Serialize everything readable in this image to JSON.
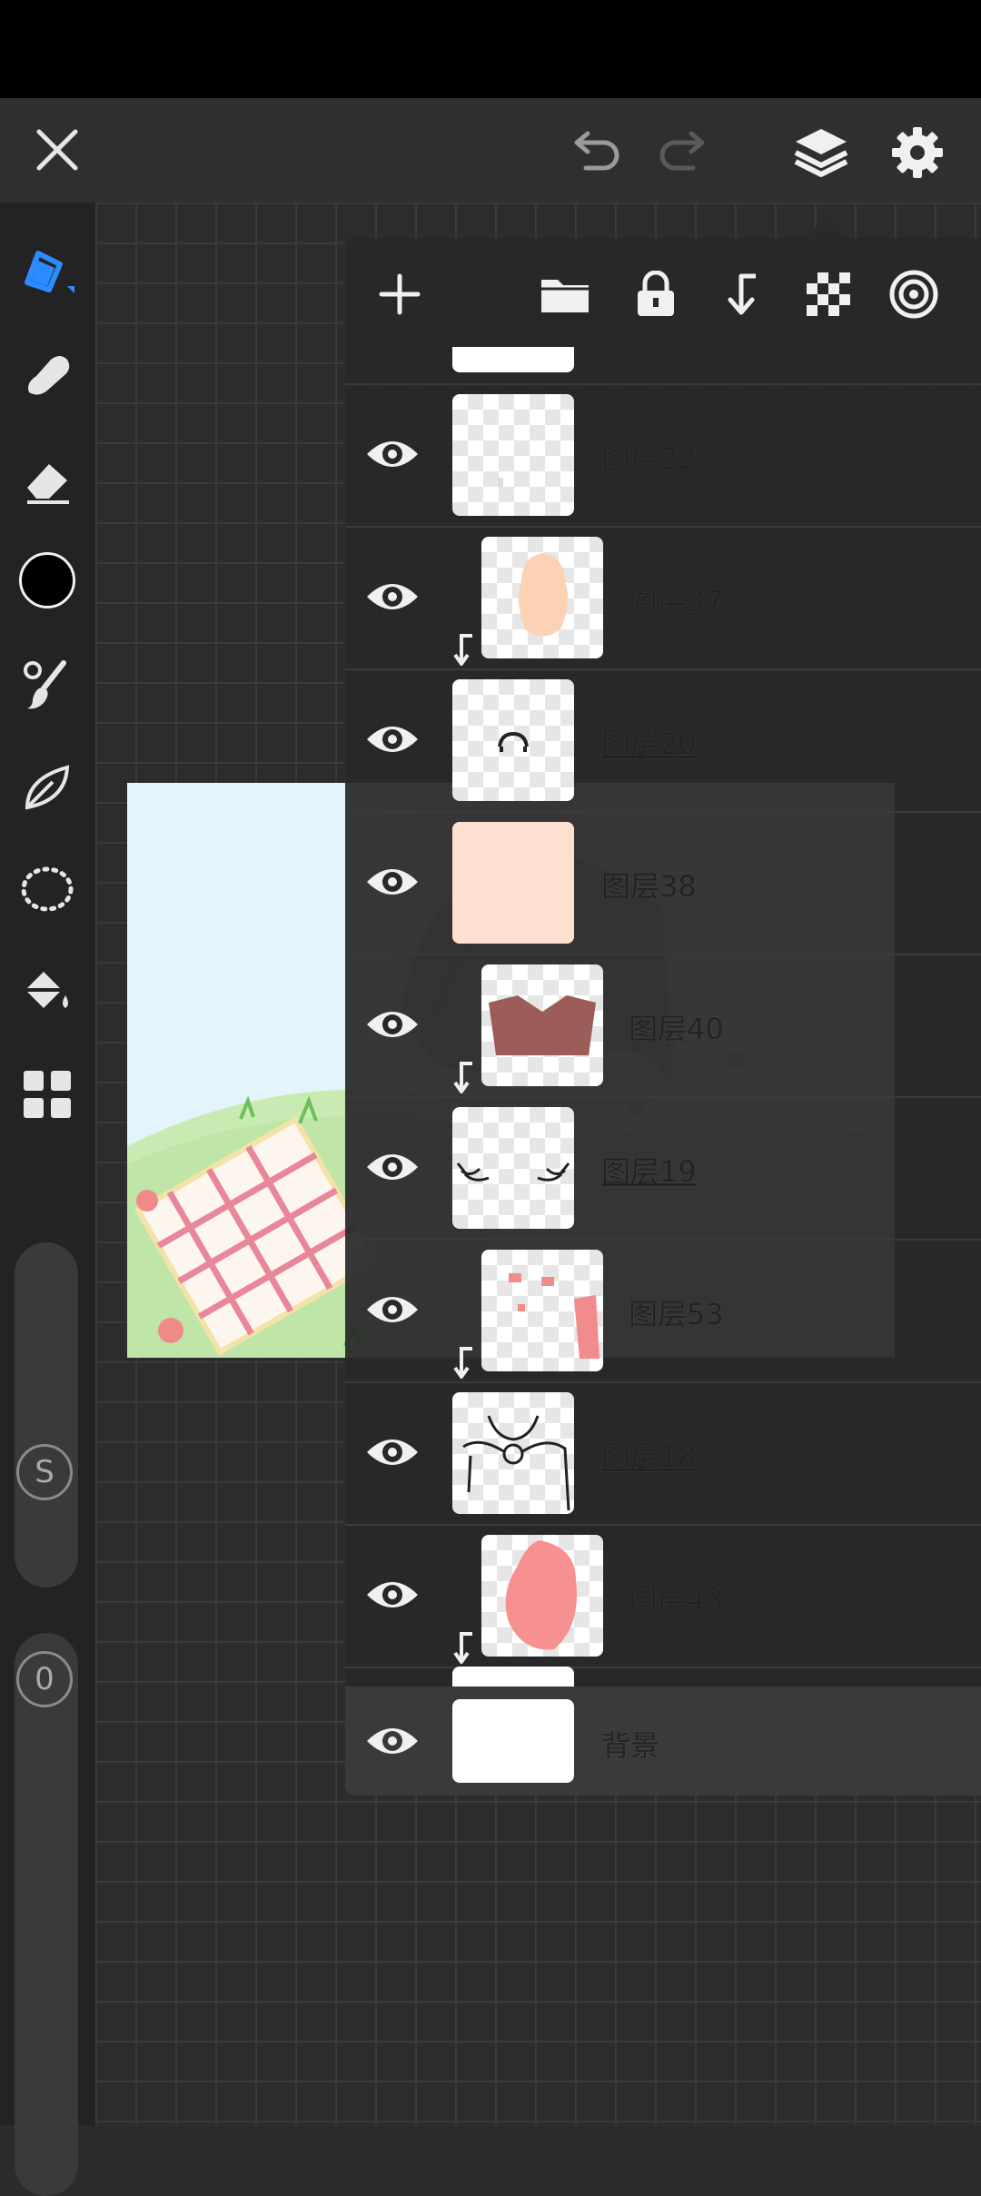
{
  "app": {
    "top_bar": {
      "close_icon": "close-icon",
      "undo_icon": "undo-icon",
      "redo_icon": "redo-icon",
      "layers_icon": "layers-icon",
      "settings_icon": "gear-icon"
    },
    "tools": [
      "pen-icon",
      "smudge-icon",
      "eraser-icon",
      "color-swatch",
      "brush-settings-icon",
      "liquify-icon",
      "lasso-icon",
      "fill-bucket-icon",
      "gallery-grid-icon"
    ],
    "current_color": "#000000",
    "size_slider_label": "S",
    "opacity_slider_label": "0"
  },
  "layer_panel": {
    "toolbar": [
      "add-layer-icon",
      "folder-icon",
      "lock-icon",
      "clip-icon",
      "transparency-icon",
      "blend-mode-icon"
    ],
    "layers": [
      {
        "name": "图层32",
        "clipped": false,
        "underline": false
      },
      {
        "name": "图层37",
        "clipped": true,
        "underline": false
      },
      {
        "name": "图层20",
        "clipped": false,
        "underline": true
      },
      {
        "name": "图层38",
        "clipped": false,
        "underline": false
      },
      {
        "name": "图层40",
        "clipped": true,
        "underline": false
      },
      {
        "name": "图层19",
        "clipped": false,
        "underline": true
      },
      {
        "name": "图层53",
        "clipped": true,
        "underline": false
      },
      {
        "name": "图层18",
        "clipped": false,
        "underline": true
      },
      {
        "name": "图层43",
        "clipped": true,
        "underline": false
      }
    ],
    "background_layer": {
      "name": "背景"
    }
  }
}
